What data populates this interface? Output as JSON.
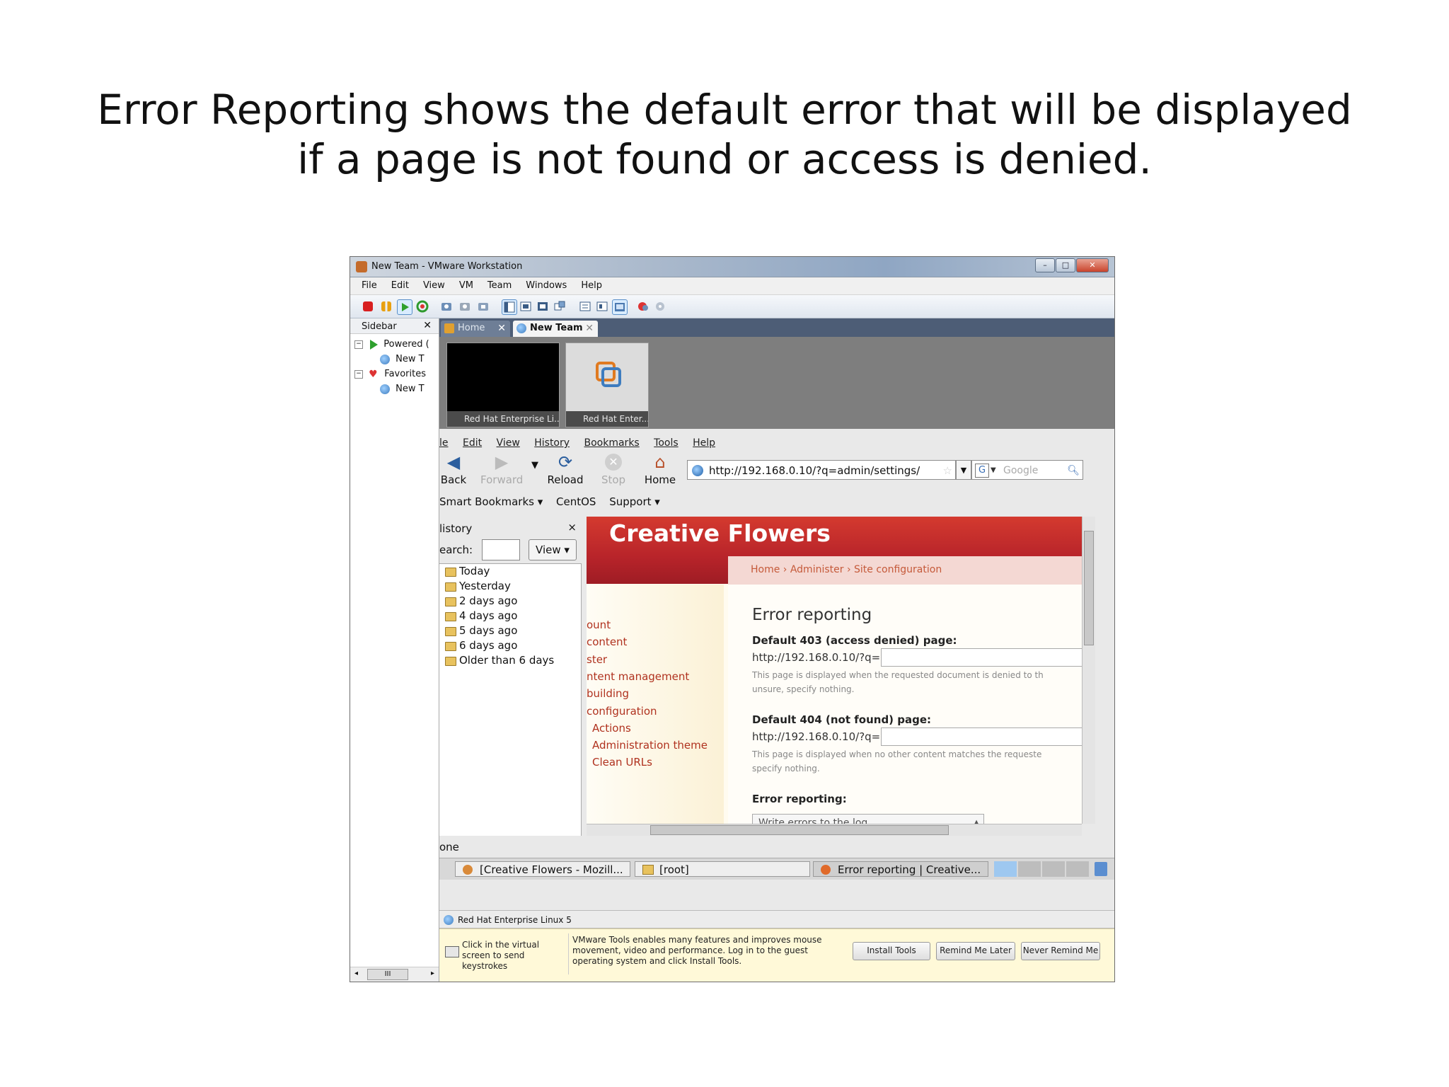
{
  "slide": {
    "title_line1": "Error Reporting shows the default error that will be displayed",
    "title_line2": "if a page is not found or access is denied."
  },
  "window": {
    "title": "New Team - VMware Workstation",
    "menu": [
      "File",
      "Edit",
      "View",
      "VM",
      "Team",
      "Windows",
      "Help"
    ]
  },
  "sidebar": {
    "title": "Sidebar",
    "close": "✕",
    "tree": [
      {
        "label": "Powered (",
        "level": 0
      },
      {
        "label": "New T",
        "level": 1
      },
      {
        "label": "Favorites",
        "level": 0
      },
      {
        "label": "New T",
        "level": 1
      }
    ],
    "scroll_grip": "III"
  },
  "tabs": [
    {
      "label": "Home",
      "active": false
    },
    {
      "label": "New Team",
      "active": true
    }
  ],
  "thumbnails": [
    {
      "label": "Red Hat Enterprise Li..."
    },
    {
      "label": "Red Hat Enter..."
    }
  ],
  "firefox": {
    "menu": [
      "le",
      "Edit",
      "View",
      "History",
      "Bookmarks",
      "Tools",
      "Help"
    ],
    "nav": {
      "back": "Back",
      "forward": "Forward",
      "reload": "Reload",
      "stop": "Stop",
      "home": "Home"
    },
    "url": "http://192.168.0.10/?q=admin/settings/",
    "search_placeholder": "Google",
    "bookmarks": [
      "Smart Bookmarks ▾",
      "CentOS",
      "Support ▾"
    ],
    "history": {
      "title": "listory",
      "close": "×",
      "search_label": "earch:",
      "view_button": "View ▾",
      "items": [
        "Today",
        "Yesterday",
        "2 days ago",
        "4 days ago",
        "5 days ago",
        "6 days ago",
        "Older than 6 days"
      ]
    },
    "status": "one"
  },
  "site": {
    "name": "Creative Flowers",
    "breadcrumb": "Home › Administer › Site configuration",
    "nav": [
      "ount",
      "content",
      "ster",
      "ntent management",
      "building",
      "configuration",
      "Actions",
      "Administration theme",
      "Clean URLs"
    ],
    "heading": "Error reporting",
    "field403_label": "Default 403 (access denied) page:",
    "field403_prefix": "http://192.168.0.10/?q=",
    "field403_desc1": "This page is displayed when the requested document is denied to th",
    "field403_desc2": "unsure, specify nothing.",
    "field404_label": "Default 404 (not found) page:",
    "field404_prefix": "http://192.168.0.10/?q=",
    "field404_desc1": "This page is displayed when no other content matches the requeste",
    "field404_desc2": "specify nothing.",
    "error_reporting_label": "Error reporting:",
    "error_reporting_value": "Write errors to the log"
  },
  "guest_taskbar": [
    {
      "label": "[Creative Flowers - Mozill..."
    },
    {
      "label": "[root]"
    },
    {
      "label": "Error reporting | Creative..."
    }
  ],
  "vm_strip": {
    "label": "Red Hat Enterprise Linux 5"
  },
  "notice": {
    "click_hint": "Click in the virtual screen to send keystrokes",
    "tools_text": "VMware Tools enables many features and improves mouse movement, video and performance. Log in to the guest operating system and click Install Tools.",
    "install": "Install Tools",
    "remind": "Remind Me Later",
    "never": "Never Remind Me"
  }
}
